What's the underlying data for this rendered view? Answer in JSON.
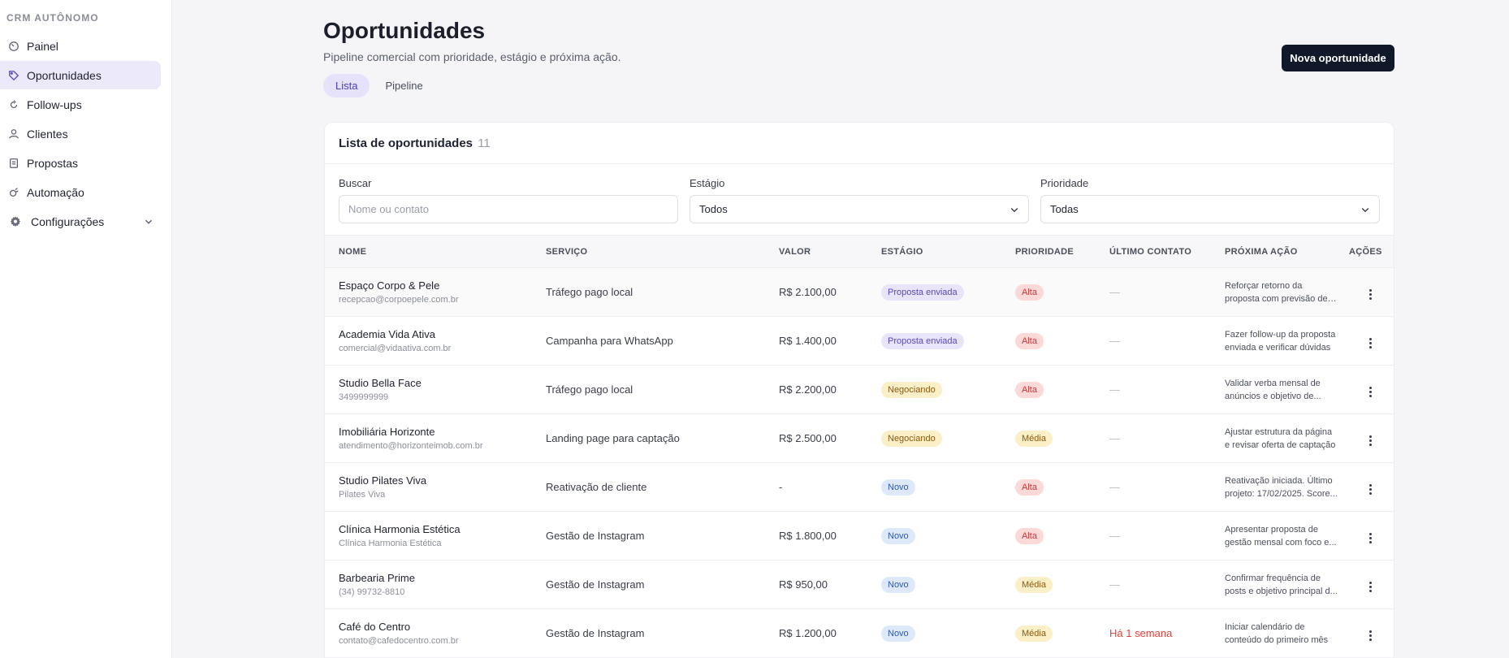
{
  "sidebar": {
    "brand": "CRM AUTÔNOMO",
    "items": [
      {
        "label": "Painel",
        "icon": "dashboard-icon"
      },
      {
        "label": "Oportunidades",
        "icon": "tag-icon",
        "active": true
      },
      {
        "label": "Follow-ups",
        "icon": "refresh-icon"
      },
      {
        "label": "Clientes",
        "icon": "user-icon"
      },
      {
        "label": "Propostas",
        "icon": "document-icon"
      },
      {
        "label": "Automação",
        "icon": "automation-icon"
      },
      {
        "label": "Configurações",
        "icon": "gear-icon"
      }
    ]
  },
  "header": {
    "title": "Oportunidades",
    "subtitle": "Pipeline comercial com prioridade, estágio e próxima ação.",
    "tabs": [
      "Lista",
      "Pipeline"
    ],
    "active_tab": "Lista",
    "new_button": "Nova oportunidade"
  },
  "card": {
    "title": "Lista de oportunidades",
    "count": "11",
    "filters": {
      "search_label": "Buscar",
      "search_placeholder": "Nome ou contato",
      "stage_label": "Estágio",
      "stage_value": "Todos",
      "priority_label": "Prioridade",
      "priority_value": "Todas"
    },
    "columns": [
      "NOME",
      "SERVIÇO",
      "VALOR",
      "ESTÁGIO",
      "PRIORIDADE",
      "ÚLTIMO CONTATO",
      "PRÓXIMA AÇÃO",
      "AÇÕES"
    ],
    "rows": [
      {
        "name": "Espaço Corpo & Pele",
        "contact": "recepcao@corpoepele.com.br",
        "service": "Tráfego pago local",
        "value": "R$ 2.100,00",
        "stage": "Proposta enviada",
        "priority": "Alta",
        "last": "—",
        "next": "Reforçar retorno da proposta com previsão de captação"
      },
      {
        "name": "Academia Vida Ativa",
        "contact": "comercial@vidaativa.com.br",
        "service": "Campanha para WhatsApp",
        "value": "R$ 1.400,00",
        "stage": "Proposta enviada",
        "priority": "Alta",
        "last": "—",
        "next": "Fazer follow-up da proposta enviada e verificar dúvidas"
      },
      {
        "name": "Studio Bella Face",
        "contact": "3499999999",
        "service": "Tráfego pago local",
        "value": "R$ 2.200,00",
        "stage": "Negociando",
        "priority": "Alta",
        "last": "—",
        "next": "Validar verba mensal de anúncios e objetivo de..."
      },
      {
        "name": "Imobiliária Horizonte",
        "contact": "atendimento@horizonteimob.com.br",
        "service": "Landing page para captação",
        "value": "R$ 2.500,00",
        "stage": "Negociando",
        "priority": "Média",
        "last": "—",
        "next": "Ajustar estrutura da página e revisar oferta de captação"
      },
      {
        "name": "Studio Pilates Viva",
        "contact": "Pilates Viva",
        "service": "Reativação de cliente",
        "value": "-",
        "stage": "Novo",
        "priority": "Alta",
        "last": "—",
        "next": "Reativação iniciada. Último projeto: 17/02/2025. Score..."
      },
      {
        "name": "Clínica Harmonia Estética",
        "contact": "Clínica Harmonia Estética",
        "service": "Gestão de Instagram",
        "value": "R$ 1.800,00",
        "stage": "Novo",
        "priority": "Alta",
        "last": "—",
        "next": "Apresentar proposta de gestão mensal com foco e..."
      },
      {
        "name": "Barbearia Prime",
        "contact": "(34) 99732-8810",
        "service": "Gestão de Instagram",
        "value": "R$ 950,00",
        "stage": "Novo",
        "priority": "Média",
        "last": "—",
        "next": "Confirmar frequência de posts e objetivo principal d..."
      },
      {
        "name": "Café do Centro",
        "contact": "contato@cafedocentro.com.br",
        "service": "Gestão de Instagram",
        "value": "R$ 1.200,00",
        "stage": "Novo",
        "priority": "Média",
        "last": "Há 1 semana",
        "next": "Iniciar calendário de conteúdo do primeiro mês"
      }
    ]
  }
}
